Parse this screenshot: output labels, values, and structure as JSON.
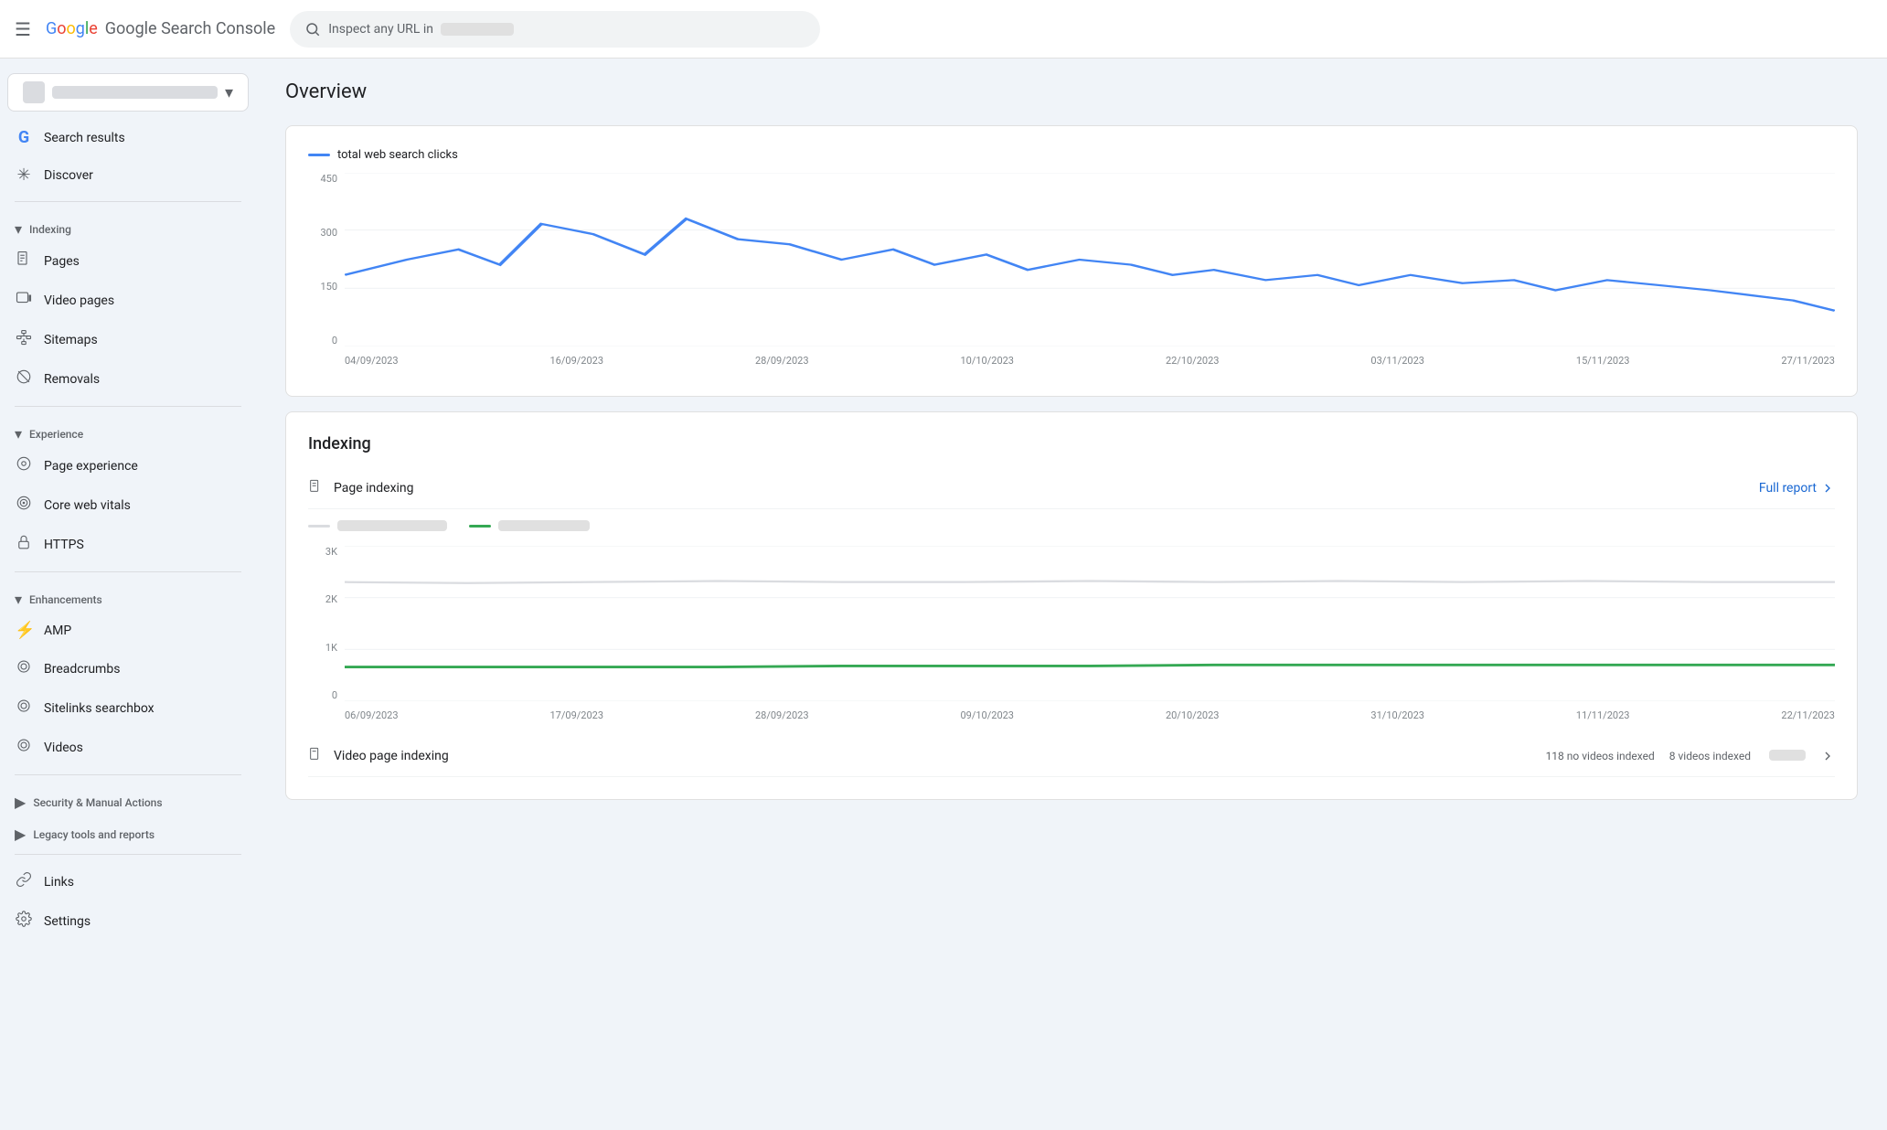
{
  "topbar": {
    "menu_icon": "☰",
    "logo_text": "Google Search Console",
    "search_placeholder": "Inspect any URL in",
    "search_domain_blur": "example.com"
  },
  "sidebar": {
    "site_name_blur": "example.com",
    "nav_sections": [
      {
        "type": "item",
        "label": "Search results",
        "icon": "G",
        "active": false
      },
      {
        "type": "item",
        "label": "Discover",
        "icon": "✳",
        "active": false
      }
    ],
    "indexing_section": {
      "label": "Indexing",
      "items": [
        {
          "label": "Pages",
          "icon": "📄"
        },
        {
          "label": "Video pages",
          "icon": "🎬"
        },
        {
          "label": "Sitemaps",
          "icon": "🗺"
        },
        {
          "label": "Removals",
          "icon": "🚫"
        }
      ]
    },
    "experience_section": {
      "label": "Experience",
      "items": [
        {
          "label": "Page experience",
          "icon": "⚙"
        },
        {
          "label": "Core web vitals",
          "icon": "⊕"
        },
        {
          "label": "HTTPS",
          "icon": "🔒"
        }
      ]
    },
    "enhancements_section": {
      "label": "Enhancements",
      "items": [
        {
          "label": "AMP",
          "icon": "⚡"
        },
        {
          "label": "Breadcrumbs",
          "icon": "◎"
        },
        {
          "label": "Sitelinks searchbox",
          "icon": "◎"
        },
        {
          "label": "Videos",
          "icon": "◎"
        }
      ]
    },
    "security_section": {
      "label": "Security & Manual Actions",
      "collapsed": true
    },
    "legacy_section": {
      "label": "Legacy tools and reports",
      "collapsed": true
    },
    "bottom_items": [
      {
        "label": "Links",
        "icon": "🔗"
      },
      {
        "label": "Settings",
        "icon": "⚙"
      }
    ]
  },
  "main": {
    "page_title": "Overview",
    "search_performance_card": {
      "legend_label": "total web search clicks",
      "y_axis": [
        "450",
        "300",
        "150",
        "0"
      ],
      "x_axis": [
        "04/09/2023",
        "16/09/2023",
        "28/09/2023",
        "10/10/2023",
        "22/10/2023",
        "03/11/2023",
        "15/11/2023",
        "27/11/2023"
      ]
    },
    "indexing_card": {
      "title": "Indexing",
      "page_indexing_label": "Page indexing",
      "full_report_label": "Full report",
      "legend": [
        {
          "color": "#dadce0",
          "label": "blurred1"
        },
        {
          "color": "#34a853",
          "label": "blurred2"
        }
      ],
      "y_axis": [
        "3K",
        "2K",
        "1K",
        "0"
      ],
      "x_axis": [
        "06/09/2023",
        "17/09/2023",
        "28/09/2023",
        "09/10/2023",
        "20/10/2023",
        "31/10/2023",
        "11/11/2023",
        "22/11/2023"
      ],
      "video_page_indexing_label": "Video page indexing",
      "no_videos_indexed": "118 no videos indexed",
      "videos_indexed": "8 videos indexed"
    }
  }
}
